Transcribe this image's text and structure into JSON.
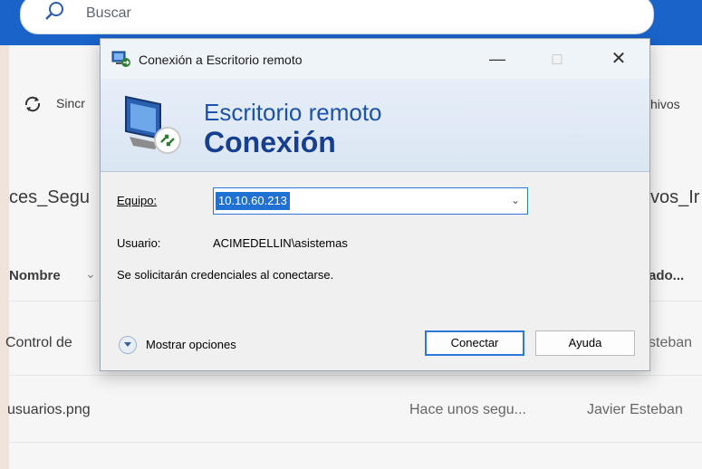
{
  "search": {
    "placeholder": "Buscar"
  },
  "background": {
    "sync_label": "Sincr",
    "right_action_label": "hivos",
    "folder_left": "ces_Segu",
    "folder_right": "vos_Ir",
    "col_name": "Nombre",
    "col_name_chevron": "⌄",
    "col_modified": "ado...",
    "row1_name": "Control de",
    "row1_user": "steban",
    "row2_name": "usuarios.png",
    "row2_time": "Hace unos segu...",
    "row2_user": "Javier Esteban"
  },
  "dialog": {
    "title": "Conexión a Escritorio remoto",
    "window_controls": {
      "minimize": "—",
      "maximize": "□",
      "close": "✕"
    },
    "banner_line1": "Escritorio remoto",
    "banner_line2": "Conexión",
    "computer_label": "Equipo:",
    "computer_value": "10.10.60.213",
    "user_label": "Usuario:",
    "user_value": "ACIMEDELLIN\\asistemas",
    "info_text": "Se solicitarán credenciales al conectarse.",
    "show_options": "Mostrar opciones",
    "connect_button": "Conectar",
    "help_button": "Ayuda"
  },
  "colors": {
    "accent": "#1a63c9",
    "banner_title": "#173f8f",
    "selection": "#1f72d4"
  },
  "icons": [
    "search-icon",
    "sync-icon",
    "rdp-app-icon",
    "rdp-banner-icon",
    "chevron-down-icon",
    "expand-options-icon"
  ]
}
